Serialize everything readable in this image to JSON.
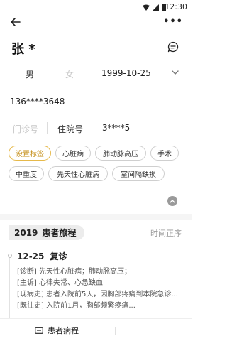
{
  "status_bar": {
    "time": "12:30"
  },
  "header": {
    "patient_name": "张 *"
  },
  "patient": {
    "gender_male": "男",
    "gender_female": "女",
    "dob": "1999-10-25",
    "phone": "136****3648",
    "outpatient_label": "门诊号",
    "inpatient_label": "住院号",
    "inpatient_number": "3****5"
  },
  "tags": [
    "设置标签",
    "心脏病",
    "肺动脉高压",
    "手术",
    "中重度",
    "先天性心脏病",
    "室间隔缺损"
  ],
  "journey": {
    "year": "2019",
    "title": "患者旅程",
    "sort_label": "时间正序",
    "visit": {
      "date": "12-25",
      "type": "复诊",
      "lines": [
        "[诊断] 先天性心脏病；肺动脉高压；",
        "[主诉] 心律失常、心急缺血",
        "[现病史] 患者入院前5天，因胸部疼痛到本院急诊...",
        "[既往史] 入院前1月，胸部频繁疼痛..."
      ]
    }
  },
  "bottom_bar": {
    "records_label": "患者病程"
  },
  "colors": {
    "accent_tag": "#c38b12",
    "accent_tag_border": "#e6b94a"
  }
}
